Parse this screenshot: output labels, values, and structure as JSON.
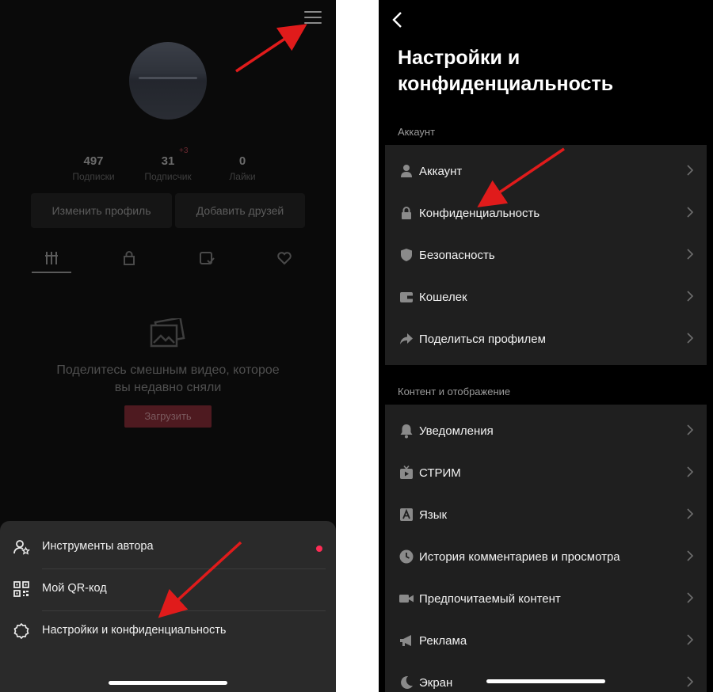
{
  "left": {
    "stats": [
      {
        "value": "497",
        "label": "Подписки"
      },
      {
        "value": "31",
        "label": "Подписчик"
      },
      {
        "value": "0",
        "label": "Лайки"
      }
    ],
    "badge": "+3",
    "buttons": {
      "edit_profile": "Изменить профиль",
      "add_friends": "Добавить друзей"
    },
    "empty_text": "Поделитесь смешным видео, которое вы недавно сняли",
    "upload": "Загрузить",
    "sheet": [
      {
        "label": "Инструменты автора",
        "icon": "person-star-icon"
      },
      {
        "label": "Мой QR-код",
        "icon": "qr-code-icon"
      },
      {
        "label": "Настройки и конфиденциальность",
        "icon": "settings-gear-icon"
      }
    ]
  },
  "right": {
    "title_line1": "Настройки и",
    "title_line2": "конфиденциальность",
    "section_account": "Аккаунт",
    "account_rows": [
      {
        "label": "Аккаунт",
        "icon": "person-icon"
      },
      {
        "label": "Конфиденциальность",
        "icon": "lock-icon"
      },
      {
        "label": "Безопасность",
        "icon": "shield-icon"
      },
      {
        "label": "Кошелек",
        "icon": "wallet-icon"
      },
      {
        "label": "Поделиться профилем",
        "icon": "share-icon"
      }
    ],
    "section_content": "Контент и отображение",
    "content_rows": [
      {
        "label": "Уведомления",
        "icon": "bell-icon"
      },
      {
        "label": "СТРИМ",
        "icon": "live-tv-icon"
      },
      {
        "label": "Язык",
        "icon": "language-icon"
      },
      {
        "label": "История комментариев и просмотра",
        "icon": "clock-icon"
      },
      {
        "label": "Предпочитаемый контент",
        "icon": "video-camera-icon"
      },
      {
        "label": "Реклама",
        "icon": "megaphone-icon"
      },
      {
        "label": "Экран",
        "icon": "moon-icon"
      }
    ]
  },
  "colors": {
    "accent": "#fe2c55",
    "arrow": "#e01b1b"
  }
}
